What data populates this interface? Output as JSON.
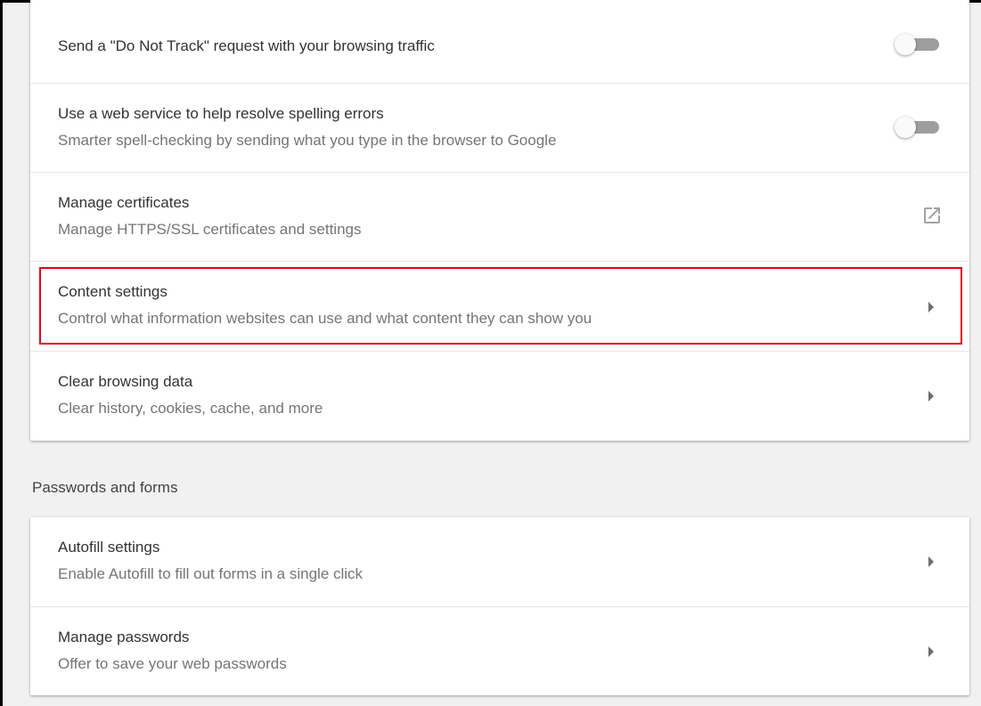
{
  "privacy": {
    "rows": [
      {
        "title": "Send a \"Do Not Track\" request with your browsing traffic",
        "control": "toggle",
        "toggle_on": false
      },
      {
        "title": "Use a web service to help resolve spelling errors",
        "subtitle": "Smarter spell-checking by sending what you type in the browser to Google",
        "control": "toggle",
        "toggle_on": false
      },
      {
        "title": "Manage certificates",
        "subtitle": "Manage HTTPS/SSL certificates and settings",
        "control": "external-link-icon"
      },
      {
        "title": "Content settings",
        "subtitle": "Control what information websites can use and what content they can show you",
        "control": "arrow-right-icon",
        "highlighted": true
      },
      {
        "title": "Clear browsing data",
        "subtitle": "Clear history, cookies, cache, and more",
        "control": "arrow-right-icon"
      }
    ]
  },
  "passwords_section": {
    "heading": "Passwords and forms",
    "rows": [
      {
        "title": "Autofill settings",
        "subtitle": "Enable Autofill to fill out forms in a single click",
        "control": "arrow-right-icon"
      },
      {
        "title": "Manage passwords",
        "subtitle": "Offer to save your web passwords",
        "control": "arrow-right-icon"
      }
    ]
  },
  "colors": {
    "highlight_border": "#e4001b",
    "toggle_track": "#9e9e9e",
    "page_background": "#f1f1f1"
  }
}
